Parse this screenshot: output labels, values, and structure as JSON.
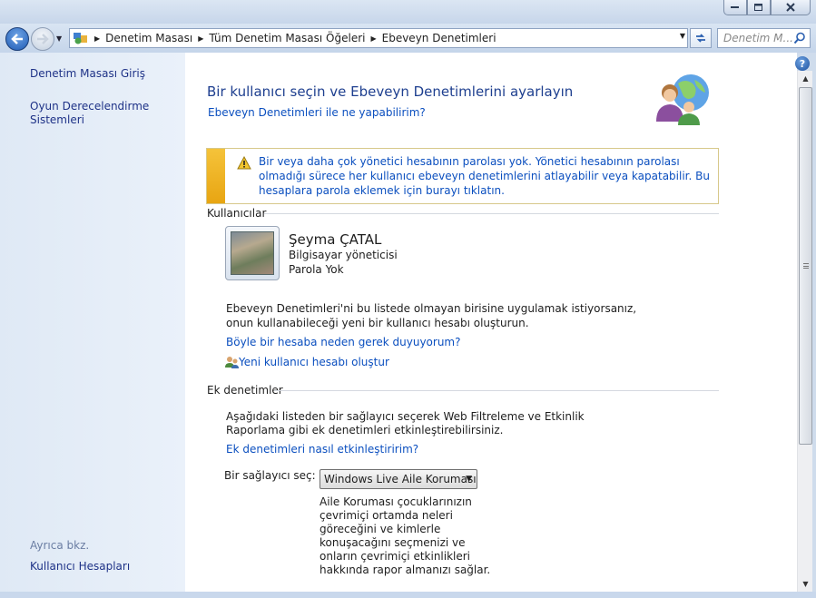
{
  "nav": {
    "breadcrumbs": [
      "Denetim Masası",
      "Tüm Denetim Masası Öğeleri",
      "Ebeveyn Denetimleri"
    ],
    "search_placeholder": "Denetim M..."
  },
  "sidebar": {
    "links": [
      {
        "label": "Denetim Masası Giriş"
      },
      {
        "label": "Oyun Derecelendirme Sistemleri"
      }
    ],
    "see_also_heading": "Ayrıca bkz.",
    "see_also_links": [
      {
        "label": "Kullanıcı Hesapları"
      }
    ]
  },
  "main": {
    "title": "Bir kullanıcı seçin ve Ebeveyn Denetimlerini ayarlayın",
    "help_link": "Ebeveyn Denetimleri ile ne yapabilirim?",
    "warning": "Bir veya daha çok yönetici hesabının parolası yok. Yönetici hesabının parolası olmadığı sürece her kullanıcı ebeveyn denetimlerini atlayabilir veya kapatabilir. Bu hesaplara parola eklemek için burayı tıklatın.",
    "users_section": {
      "heading": "Kullanıcılar",
      "user": {
        "name": "Şeyma ÇATAL",
        "role": "Bilgisayar yöneticisi",
        "password_status": "Parola Yok"
      },
      "apply_text_1": "Ebeveyn Denetimleri'ni bu listede olmayan birisine uygulamak istiyorsanız,",
      "apply_text_2": "onun kullanabileceği yeni bir kullanıcı hesabı oluşturun.",
      "why_link": "Böyle bir hesaba neden gerek duyuyorum?",
      "create_link": "Yeni kullanıcı hesabı oluştur"
    },
    "extra_section": {
      "heading": "Ek denetimler",
      "text_1": "Aşağıdaki listeden bir sağlayıcı seçerek Web Filtreleme ve Etkinlik",
      "text_2": "Raporlama gibi ek denetimleri etkinleştirebilirsiniz.",
      "how_link": "Ek denetimleri nasıl etkinleştiririm?",
      "provider_label": "Bir sağlayıcı seç:",
      "provider_selected": "Windows Live Aile Koruması",
      "provider_desc_lines": [
        "Aile Koruması çocuklarınızın",
        "çevrimiçi ortamda neleri",
        "göreceğini ve kimlerle",
        "konuşacağını seçmenizi ve",
        "onların çevrimiçi etkinlikleri",
        "hakkında rapor almanızı sağlar."
      ]
    }
  },
  "colors": {
    "link": "#0b4fbf",
    "title": "#1e3f8f",
    "warning_stripe": "#f5c33a"
  },
  "icons": [
    "back-arrow-icon",
    "forward-arrow-icon",
    "control-panel-icon",
    "refresh-icon",
    "search-icon",
    "help-icon",
    "parental-controls-icon",
    "warning-icon",
    "user-accounts-icon"
  ]
}
